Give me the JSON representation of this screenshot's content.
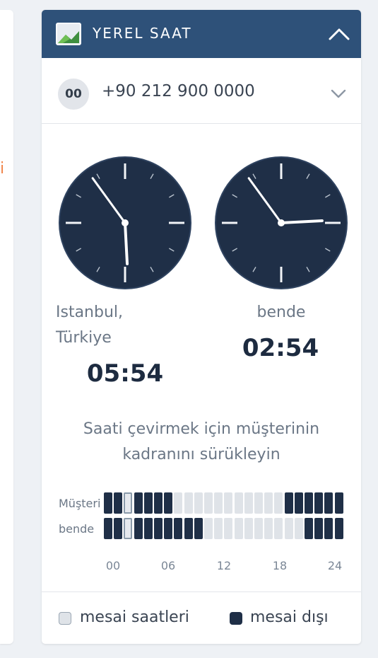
{
  "left_fragment": "i",
  "header": {
    "title": "YEREL SAAT",
    "icon": "image-icon",
    "toggle_icon": "chevron-up-icon"
  },
  "phone": {
    "flag_label": "00",
    "number": "+90 212 900 0000",
    "dropdown_icon": "chevron-down-icon"
  },
  "clocks": [
    {
      "caption_line1": "Istanbul,",
      "caption_line2": "Türkiye",
      "time": "05:54"
    },
    {
      "caption_line1": "bende",
      "caption_line2": "",
      "time": "02:54"
    }
  ],
  "hint": {
    "line1": "Saati çevirmek için müşterinin",
    "line2": "kadranını sürükleyin"
  },
  "timeline": {
    "rows": [
      {
        "label": "Müşteri",
        "hours": [
          0,
          0,
          1,
          0,
          0,
          0,
          0,
          1,
          1,
          1,
          1,
          1,
          1,
          1,
          1,
          1,
          1,
          1,
          0,
          0,
          0,
          0,
          0,
          0
        ]
      },
      {
        "label": "bende",
        "hours": [
          0,
          0,
          1,
          0,
          0,
          0,
          0,
          0,
          0,
          0,
          1,
          1,
          1,
          1,
          1,
          1,
          1,
          1,
          1,
          1,
          0,
          0,
          0,
          0
        ]
      }
    ],
    "current_hour": 2,
    "ticks": [
      "00",
      "06",
      "12",
      "18",
      "24"
    ]
  },
  "legend": {
    "working_label": "mesai saatleri",
    "off_label": "mesai dışı"
  },
  "colors": {
    "header_bg": "#2e5179",
    "clock_face": "#1f2f47",
    "off_cell": "#1f2f47",
    "on_cell": "#dfe3e8"
  }
}
